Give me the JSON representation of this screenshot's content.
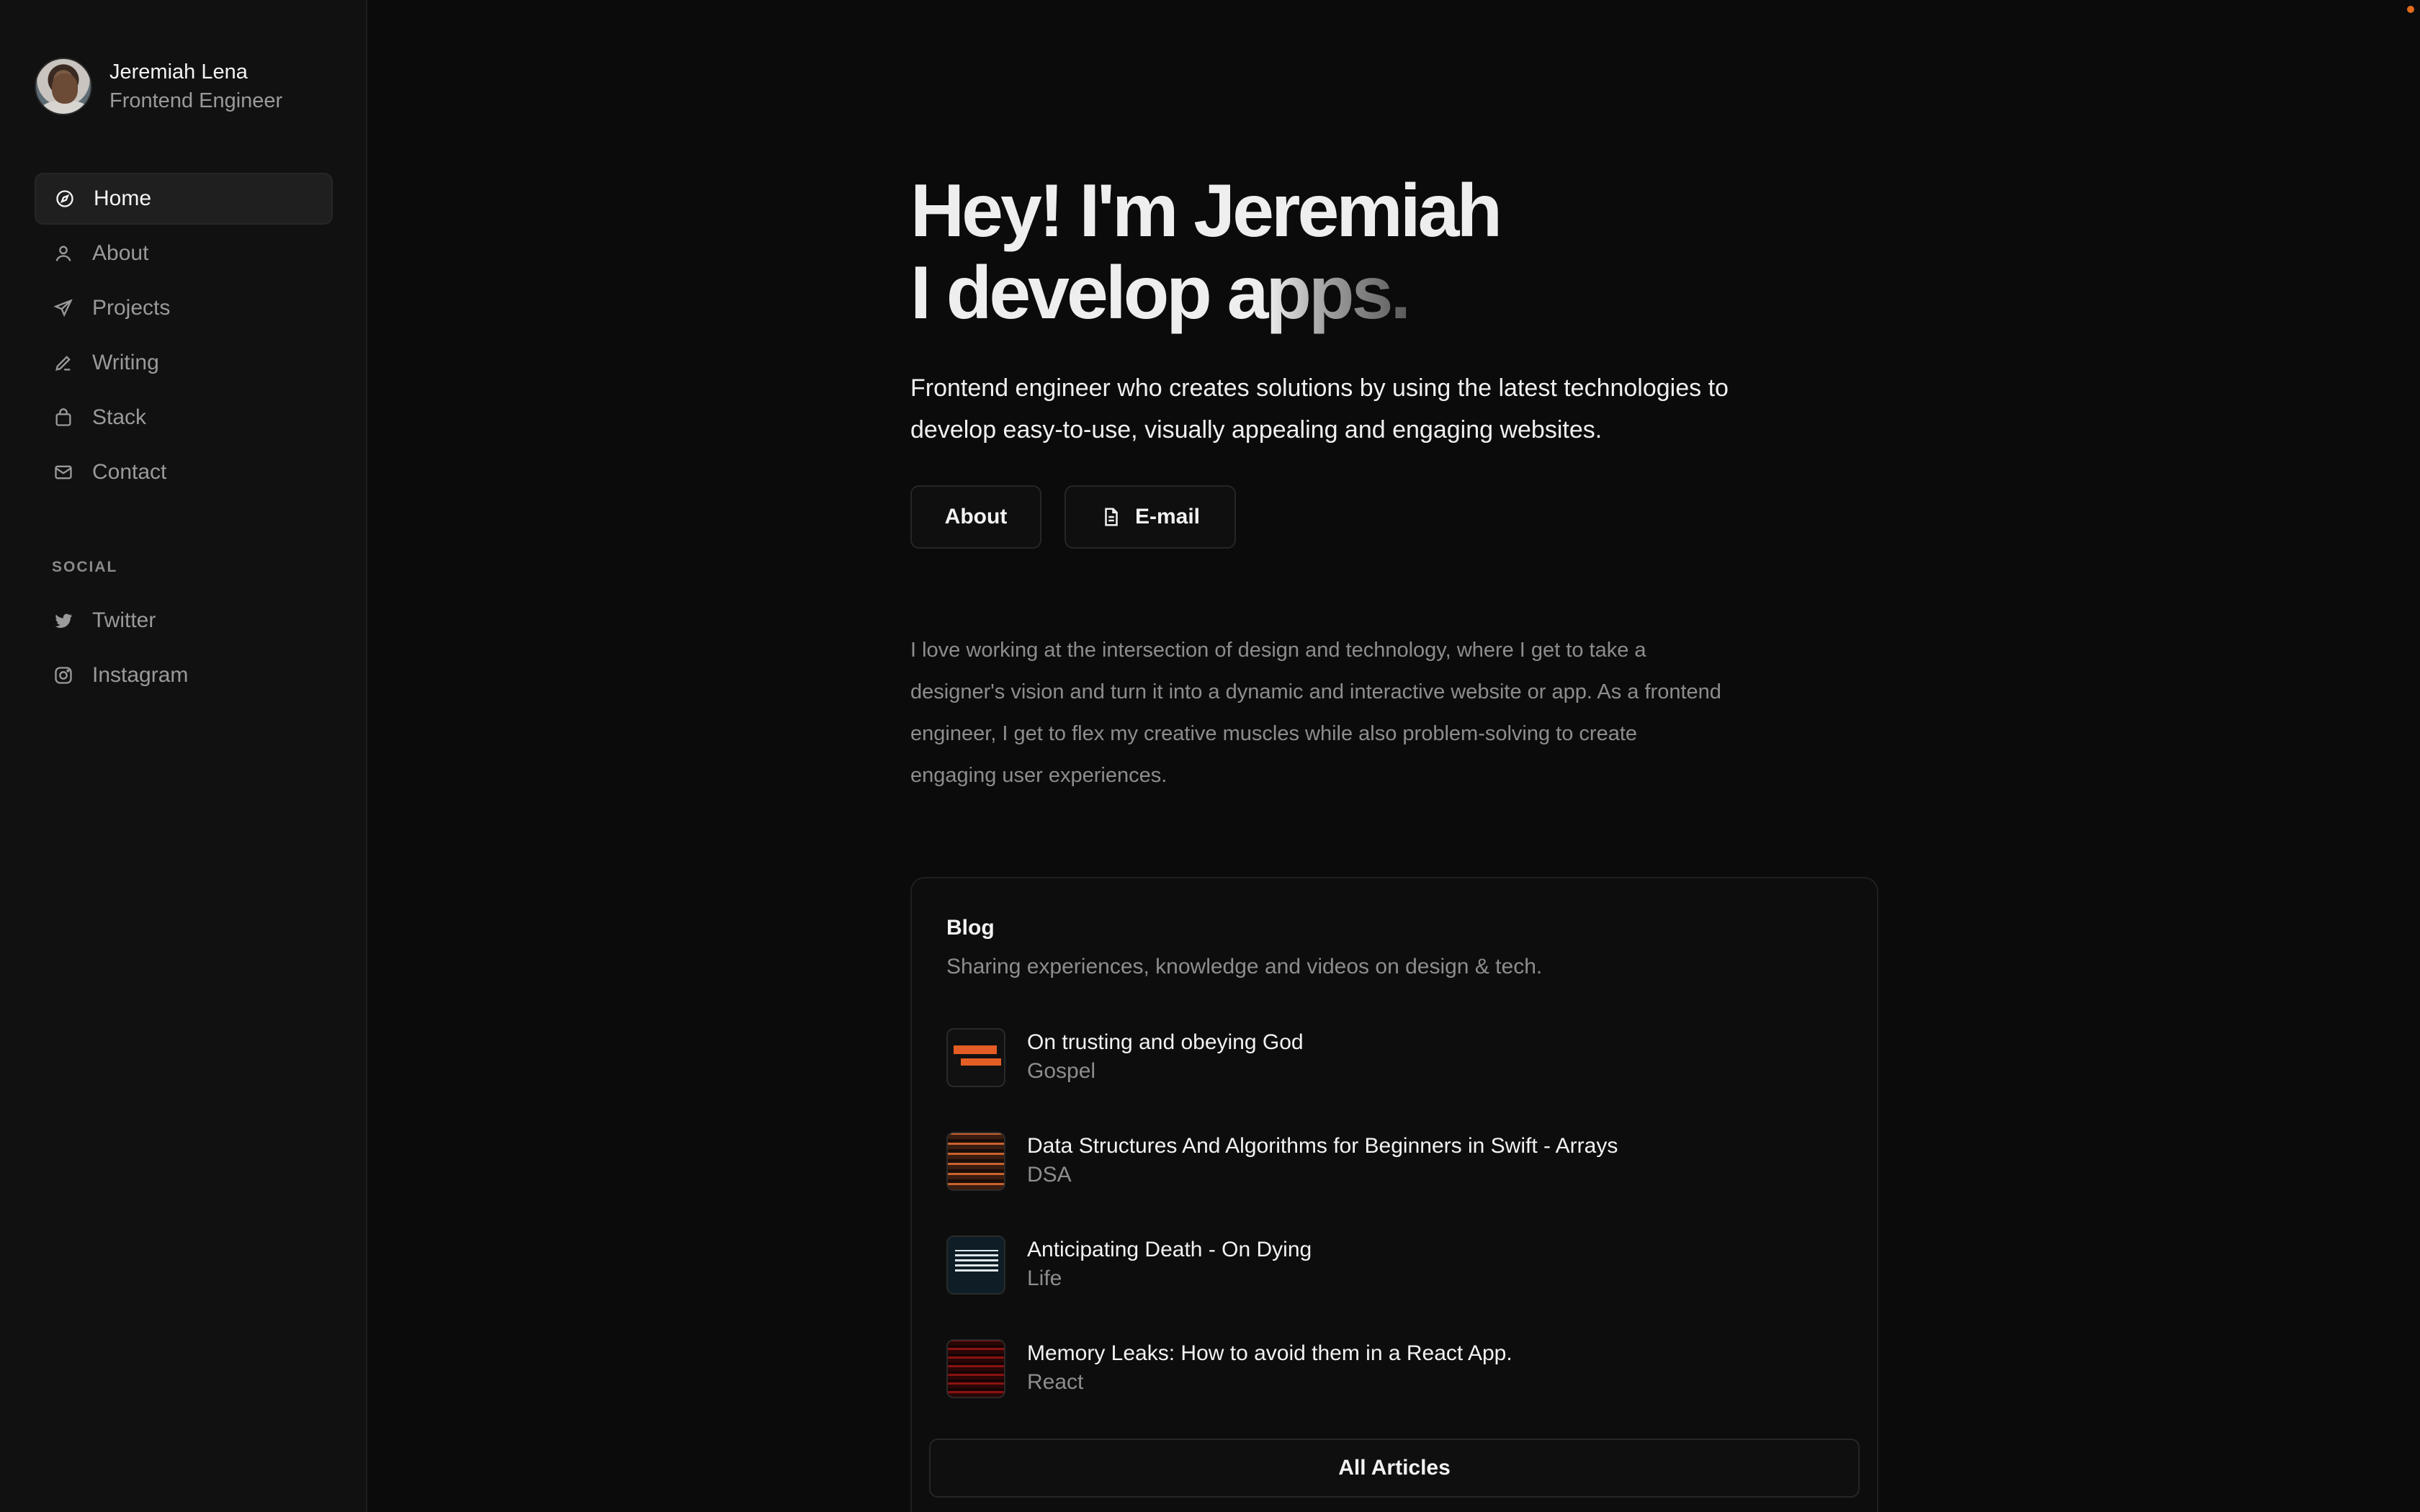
{
  "profile": {
    "name": "Jeremiah Lena",
    "role": "Frontend Engineer"
  },
  "nav": [
    {
      "label": "Home",
      "icon": "compass-icon",
      "active": true
    },
    {
      "label": "About",
      "icon": "user-icon"
    },
    {
      "label": "Projects",
      "icon": "send-icon"
    },
    {
      "label": "Writing",
      "icon": "pencil-icon"
    },
    {
      "label": "Stack",
      "icon": "bag-icon"
    },
    {
      "label": "Contact",
      "icon": "mail-icon"
    }
  ],
  "social": {
    "heading": "SOCIAL",
    "items": [
      {
        "label": "Twitter",
        "icon": "twitter-icon"
      },
      {
        "label": "Instagram",
        "icon": "instagram-icon"
      }
    ]
  },
  "hero": {
    "line1": "Hey! I'm Jeremiah",
    "line2_solid": "I develop a",
    "line2_fade": "pps.",
    "lead": "Frontend engineer who creates solutions by using the latest technologies to develop easy-to-use, visually appealing and engaging websites.",
    "about_button": "About",
    "email_button": "E-mail"
  },
  "intro": "I love working at the intersection of design and technology, where I get to take a designer's vision and turn it into a dynamic and interactive website or app. As a frontend engineer, I get to flex my creative muscles while also problem-solving to create engaging user experiences.",
  "blog": {
    "title": "Blog",
    "subtitle": "Sharing experiences, knowledge and videos on design & tech.",
    "posts": [
      {
        "title": "On trusting and obeying God",
        "category": "Gospel"
      },
      {
        "title": "Data Structures And Algorithms for Beginners in Swift - Arrays",
        "category": "DSA"
      },
      {
        "title": "Anticipating Death - On Dying",
        "category": "Life"
      },
      {
        "title": "Memory Leaks: How to avoid them in a React App.",
        "category": "React"
      }
    ],
    "all_button": "All Articles"
  },
  "colors": {
    "background": "#0b0b0b",
    "sidebar": "#111111",
    "accent_dot": "#e36b1c"
  }
}
